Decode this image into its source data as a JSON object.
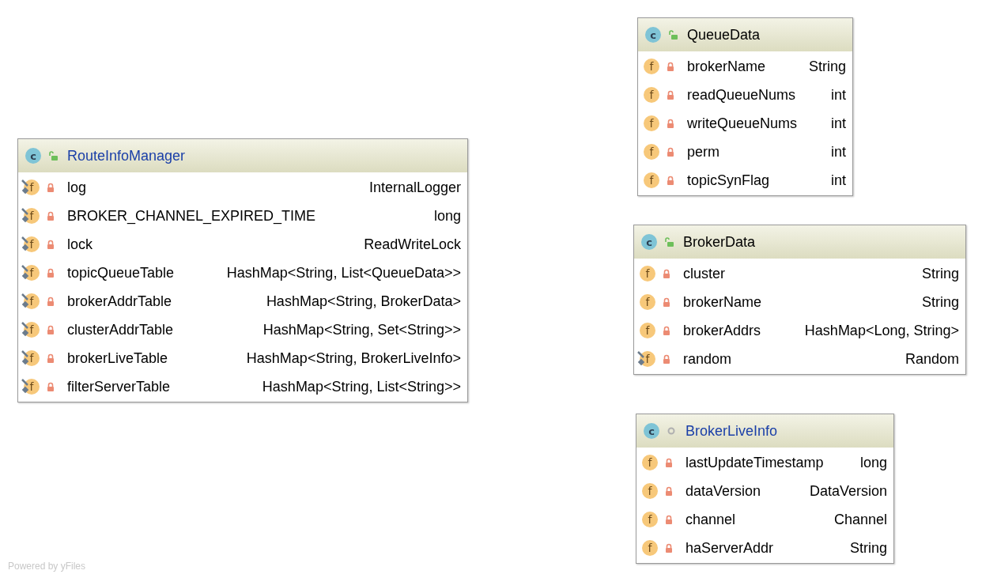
{
  "classes": [
    {
      "icon": "c",
      "name": "RouteInfoManager",
      "is_public": true,
      "title_highlighted": true,
      "fields": [
        {
          "icon": "f",
          "name": "log",
          "type": "InternalLogger",
          "static": true
        },
        {
          "icon": "f",
          "name": "BROKER_CHANNEL_EXPIRED_TIME",
          "type": "long",
          "static": true
        },
        {
          "icon": "f",
          "name": "lock",
          "type": "ReadWriteLock",
          "static": true
        },
        {
          "icon": "f",
          "name": "topicQueueTable",
          "type": "HashMap<String, List<QueueData>>",
          "static": true
        },
        {
          "icon": "f",
          "name": "brokerAddrTable",
          "type": "HashMap<String, BrokerData>",
          "static": true
        },
        {
          "icon": "f",
          "name": "clusterAddrTable",
          "type": "HashMap<String, Set<String>>",
          "static": true
        },
        {
          "icon": "f",
          "name": "brokerLiveTable",
          "type": "HashMap<String, BrokerLiveInfo>",
          "static": true
        },
        {
          "icon": "f",
          "name": "filterServerTable",
          "type": "HashMap<String, List<String>>",
          "static": true
        }
      ]
    },
    {
      "icon": "c",
      "name": "QueueData",
      "is_public": true,
      "title_highlighted": false,
      "fields": [
        {
          "icon": "f",
          "name": "brokerName",
          "type": "String",
          "static": false
        },
        {
          "icon": "f",
          "name": "readQueueNums",
          "type": "int",
          "static": false
        },
        {
          "icon": "f",
          "name": "writeQueueNums",
          "type": "int",
          "static": false
        },
        {
          "icon": "f",
          "name": "perm",
          "type": "int",
          "static": false
        },
        {
          "icon": "f",
          "name": "topicSynFlag",
          "type": "int",
          "static": false
        }
      ]
    },
    {
      "icon": "c",
      "name": "BrokerData",
      "is_public": true,
      "title_highlighted": false,
      "fields": [
        {
          "icon": "f",
          "name": "cluster",
          "type": "String",
          "static": false
        },
        {
          "icon": "f",
          "name": "brokerName",
          "type": "String",
          "static": false
        },
        {
          "icon": "f",
          "name": "brokerAddrs",
          "type": "HashMap<Long, String>",
          "static": false
        },
        {
          "icon": "f",
          "name": "random",
          "type": "Random",
          "static": true
        }
      ]
    },
    {
      "icon": "c",
      "name": "BrokerLiveInfo",
      "is_public": false,
      "title_highlighted": true,
      "fields": [
        {
          "icon": "f",
          "name": "lastUpdateTimestamp",
          "type": "long",
          "static": false
        },
        {
          "icon": "f",
          "name": "dataVersion",
          "type": "DataVersion",
          "static": false
        },
        {
          "icon": "f",
          "name": "channel",
          "type": "Channel",
          "static": false
        },
        {
          "icon": "f",
          "name": "haServerAddr",
          "type": "String",
          "static": false
        }
      ]
    }
  ],
  "footer": "Powered by yFiles"
}
